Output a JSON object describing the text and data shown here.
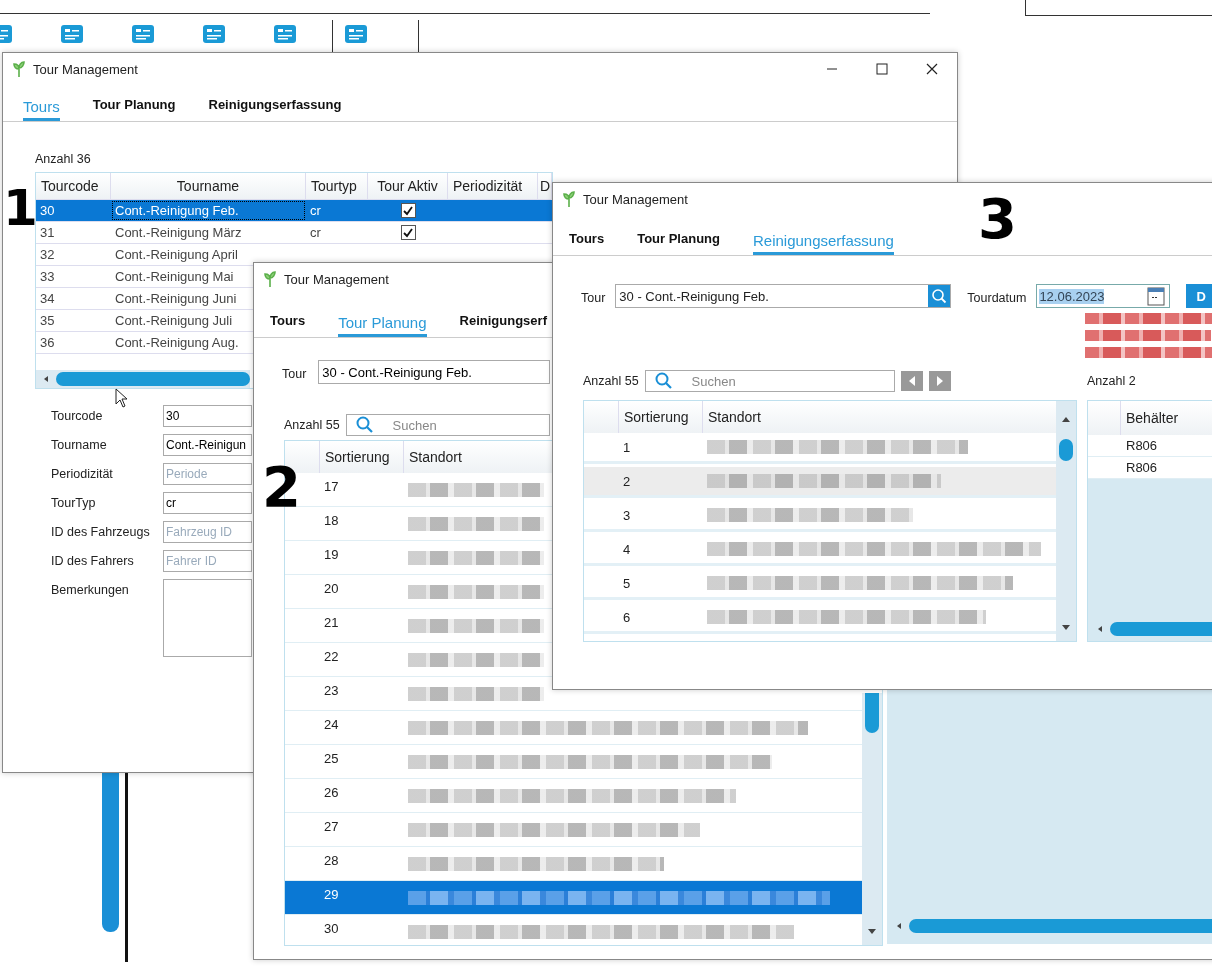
{
  "tours_window": {
    "title": "Tour Management",
    "annotation": "1",
    "tabs": [
      {
        "label": "Tours",
        "selected": true
      },
      {
        "label": "Tour Planung",
        "selected": false
      },
      {
        "label": "Reinigungserfassung",
        "selected": false
      }
    ],
    "count": "Anzahl 36",
    "columns": [
      "Tourcode",
      "Tourname",
      "Tourtyp",
      "Tour Aktiv",
      "Periodizität",
      "D"
    ],
    "rows": [
      {
        "cells": [
          "30",
          "Cont.-Reinigung Feb.",
          "cr"
        ],
        "active": true,
        "selected": true
      },
      {
        "cells": [
          "31",
          "Cont.-Reinigung März",
          "cr"
        ],
        "active": true,
        "selected": false
      },
      {
        "cells": [
          "32",
          "Cont.-Reinigung April"
        ],
        "selected": false
      },
      {
        "cells": [
          "33",
          "Cont.-Reinigung Mai"
        ],
        "selected": false
      },
      {
        "cells": [
          "34",
          "Cont.-Reinigung Juni"
        ],
        "selected": false
      },
      {
        "cells": [
          "35",
          "Cont.-Reinigung Juli"
        ],
        "selected": false
      },
      {
        "cells": [
          "36",
          "Cont.-Reinigung Aug."
        ],
        "selected": false
      }
    ],
    "form": [
      {
        "kind": "input",
        "label": "Tourcode",
        "value": "30"
      },
      {
        "kind": "input",
        "label": "Tourname",
        "value": "Cont.-Reinigun"
      },
      {
        "kind": "input",
        "label": "Periodizität",
        "placeholder": "Periode"
      },
      {
        "kind": "input",
        "label": "TourTyp",
        "value": "cr"
      },
      {
        "kind": "input",
        "label": "ID des Fahrzeugs",
        "placeholder": "Fahrzeug ID"
      },
      {
        "kind": "input",
        "label": "ID des Fahrers",
        "placeholder": "Fahrer ID"
      },
      {
        "kind": "textarea",
        "label": "Bemerkungen"
      }
    ]
  },
  "planning_window": {
    "title": "Tour Management",
    "annotation": "2",
    "tabs": [
      {
        "label": "Tours",
        "selected": false
      },
      {
        "label": "Tour Planung",
        "selected": true
      },
      {
        "label": "Reinigungserf",
        "selected": false
      }
    ],
    "tour_label": "Tour",
    "tour_value": "30 - Cont.-Reinigung Feb.",
    "count": "Anzahl 55",
    "search_placeholder": "Suchen",
    "columns": [
      "Sortierung",
      "Standort"
    ],
    "rows": [
      {
        "sort": "17",
        "selected": false
      },
      {
        "sort": "18",
        "selected": false
      },
      {
        "sort": "19",
        "selected": false
      },
      {
        "sort": "20",
        "selected": false
      },
      {
        "sort": "21",
        "selected": false
      },
      {
        "sort": "22",
        "selected": false
      },
      {
        "sort": "23",
        "selected": false
      },
      {
        "sort": "24",
        "selected": false
      },
      {
        "sort": "25",
        "selected": false
      },
      {
        "sort": "26",
        "selected": false
      },
      {
        "sort": "27",
        "selected": false
      },
      {
        "sort": "28",
        "selected": false
      },
      {
        "sort": "29",
        "selected": true
      },
      {
        "sort": "30",
        "selected": false
      }
    ]
  },
  "cleaning_window": {
    "title": "Tour Management",
    "annotation": "3",
    "tabs": [
      {
        "label": "Tours",
        "selected": false
      },
      {
        "label": "Tour Planung",
        "selected": false
      },
      {
        "label": "Reinigungserfassung",
        "selected": true
      }
    ],
    "tour_label": "Tour",
    "tour_value": "30 - Cont.-Reinigung Feb.",
    "date_label": "Tourdatum",
    "date_value": "12.06.2023",
    "action_button": "D",
    "count": "Anzahl 55",
    "search_placeholder": "Suchen",
    "columns": [
      "Sortierung",
      "Standort"
    ],
    "rows": [
      {
        "sort": "1",
        "highlighted": false
      },
      {
        "sort": "2",
        "highlighted": true
      },
      {
        "sort": "3",
        "highlighted": false
      },
      {
        "sort": "4",
        "highlighted": false
      },
      {
        "sort": "5",
        "highlighted": false
      },
      {
        "sort": "6",
        "highlighted": false
      }
    ],
    "side_count": "Anzahl 2",
    "side_columns": [
      "Behälter"
    ],
    "side_rows": [
      "R806",
      "R806"
    ]
  }
}
